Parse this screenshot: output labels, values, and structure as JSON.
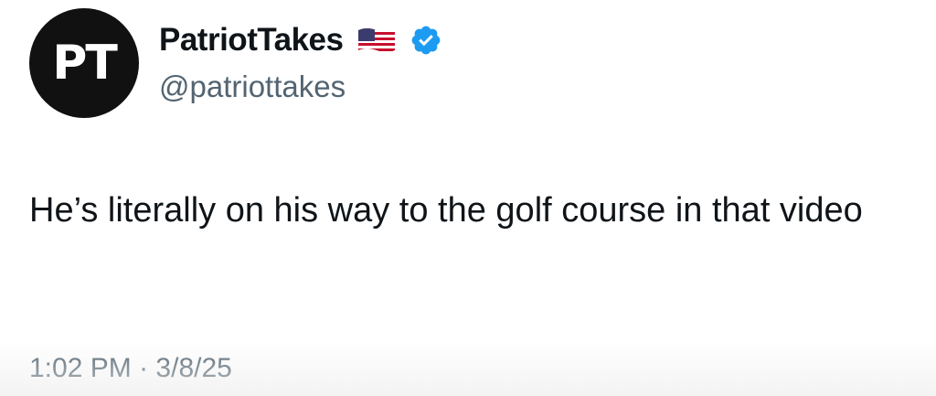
{
  "author": {
    "avatar_text": "PT",
    "display_name": "PatriotTakes",
    "handle": "@patriottakes",
    "flag_icon": "us-flag-icon",
    "verified_icon": "verified-badge-icon",
    "verified_color": "#1d9bf0"
  },
  "tweet": {
    "text": "He’s literally on his way to the golf course in that video",
    "time": "1:02 PM",
    "separator": "·",
    "date": "3/8/25"
  },
  "colors": {
    "text_primary": "#0f1419",
    "text_secondary": "#536471",
    "avatar_bg": "#111111"
  }
}
